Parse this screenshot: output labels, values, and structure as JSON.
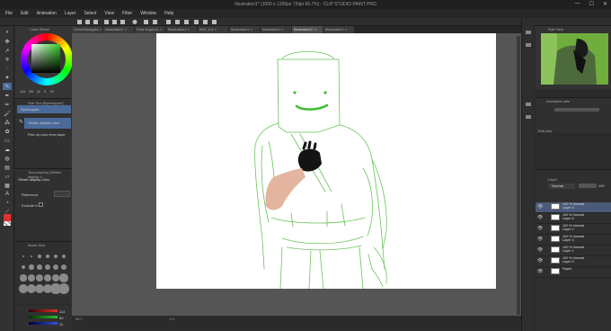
{
  "window": {
    "title": "Illustration1* (1000 x 1200px 72dpi 66.7%)  - CLIP STUDIO PAINT PRO",
    "controls": [
      "—",
      "☐",
      "✕"
    ]
  },
  "menu": [
    "File",
    "Edit",
    "Animation",
    "Layer",
    "Select",
    "View",
    "Filter",
    "Window",
    "Help"
  ],
  "tabs": [
    {
      "label": "GreenStudgebo ×",
      "active": false
    },
    {
      "label": "Illustration1 ×",
      "active": false
    },
    {
      "label": "Face Irrgub11 ×",
      "active": false
    },
    {
      "label": "Illustration1 ×",
      "active": false
    },
    {
      "label": "IMG_6.4 ×",
      "active": false
    },
    {
      "label": "Illustration1 ×",
      "active": false
    },
    {
      "label": "Illustration1 ×",
      "active": false
    },
    {
      "label": "Illustration1* ×",
      "active": true
    },
    {
      "label": "Illustration1 ×",
      "active": false
    }
  ],
  "color_panel": {
    "title": "Color Wheel",
    "values": [
      "114",
      "89",
      "11",
      "0",
      "76"
    ],
    "ring_colors": [
      "#ff0000",
      "#ffff00",
      "#00ff00",
      "#00ffff",
      "#0000ff",
      "#ff00ff"
    ],
    "current_hue": "#2ecc20"
  },
  "subtool": {
    "title": "Sub Tool [Eyedropper]",
    "items": [
      {
        "label": "Eyedropper",
        "selected": true
      },
      {
        "label": "Obtain display color",
        "selected": true
      },
      {
        "label": "Pick up color from layer",
        "selected": false
      }
    ]
  },
  "tool_property": {
    "title": "Tool property [Obtain display c...",
    "subtitle": "Obtain display color",
    "reference_label": "Reference",
    "exclude_label": "Exclude fr..."
  },
  "brush_size": {
    "title": "Brush Size",
    "sizes": [
      "0.7",
      "1",
      "1.5",
      "2",
      "2.5",
      "3",
      "4",
      "5",
      "6",
      "7",
      "8",
      "10",
      "12",
      "15",
      "17",
      "20",
      "25",
      "30",
      "40",
      "50",
      "60",
      "70",
      "80",
      "100"
    ]
  },
  "color_sliders": {
    "values": [
      "114",
      "89",
      "11"
    ],
    "colors": [
      "#e03030",
      "#30c030",
      "#3050e0"
    ]
  },
  "canvas": {
    "status_left": "66.7",
    "status_mid": "0.0",
    "line_color": "#6ac35a",
    "smile_color": "#3fbf2f"
  },
  "navigator": {
    "title": "Sub View"
  },
  "layer_property": {
    "title": "Animation cels",
    "sub": "Edit cels"
  },
  "layers": {
    "title": "Layer",
    "blend_mode": "Normal",
    "opacity": "100",
    "rows": [
      {
        "pct": "100 % Normal",
        "name": "Layer 4",
        "selected": true
      },
      {
        "pct": "100 % Normal",
        "name": "Layer 6",
        "selected": false
      },
      {
        "pct": "100 % Normal",
        "name": "Layer 2",
        "selected": false
      },
      {
        "pct": "100 % Normal",
        "name": "Layer 3",
        "selected": false
      },
      {
        "pct": "100 % Normal",
        "name": "Layer 1",
        "selected": false
      },
      {
        "pct": "100 % Normal",
        "name": "Layer 5",
        "selected": false
      },
      {
        "pct": "",
        "name": "Paper",
        "selected": false
      }
    ]
  }
}
